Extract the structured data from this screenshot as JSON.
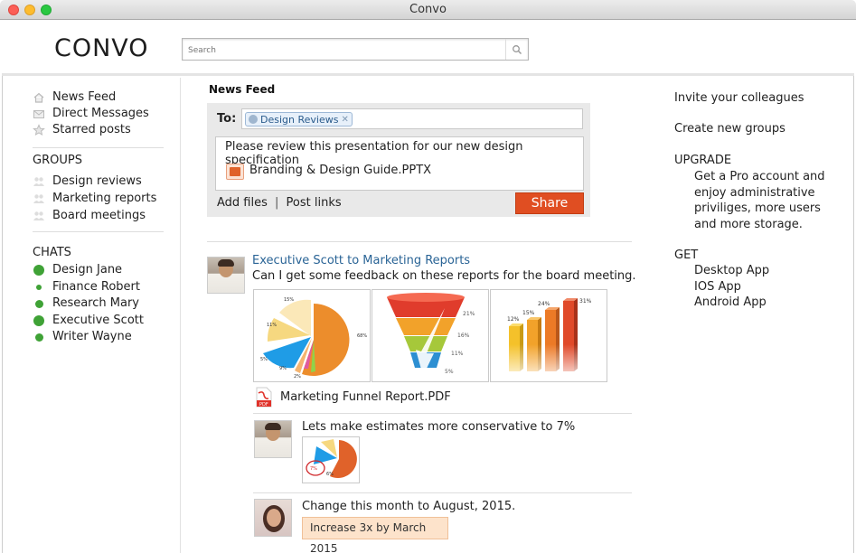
{
  "window": {
    "title": "Convo"
  },
  "header": {
    "logo": "CONVO",
    "search_placeholder": "Search"
  },
  "sidebar": {
    "nav": [
      "News Feed",
      "Direct Messages",
      "Starred posts"
    ],
    "groups_heading": "GROUPS",
    "groups": [
      "Design reviews",
      "Marketing reports",
      "Board meetings"
    ],
    "chats_heading": "CHATS",
    "chats": [
      "Design Jane",
      "Finance Robert",
      "Research Mary",
      "Executive Scott",
      "Writer Wayne"
    ]
  },
  "composer": {
    "heading": "News Feed",
    "to_label": "To:",
    "to_tag": "Design Reviews",
    "message": "Please review this presentation for our new design specification",
    "attachment": "Branding & Design Guide.PPTX",
    "add_files": "Add files",
    "divider": "|",
    "post_links": "Post links",
    "share": "Share"
  },
  "post": {
    "author_line": "Executive Scott to Marketing Reports",
    "text": "Can I get some feedback on these reports for the board meeting.",
    "attachment": "Marketing Funnel Report.PDF",
    "pdf_label": "PDF",
    "pie_labels": [
      "15%",
      "11%",
      "68%",
      "5%",
      "9%",
      "2%"
    ],
    "funnel_labels": [
      "21%",
      "16%",
      "11%",
      "5%"
    ],
    "bar_labels": [
      "12%",
      "15%",
      "24%",
      "31%"
    ]
  },
  "replies": [
    {
      "text": "Lets make estimates more conservative to 7%",
      "thumb_labels": [
        "7%",
        "6%"
      ]
    },
    {
      "text": "Change this month to August, 2015.",
      "note": "Increase 3x by March 2015"
    }
  ],
  "right": {
    "invite": "Invite your colleagues",
    "create": "Create new groups",
    "upgrade_heading": "UPGRADE",
    "upgrade_text": [
      "Get a Pro account and",
      "enjoy administrative",
      "priviliges, more users",
      "and more storage."
    ],
    "get_heading": "GET",
    "apps": [
      "Desktop App",
      "IOS App",
      "Android App"
    ]
  },
  "colors": {
    "accent": "#e04e22",
    "link": "#2a6496",
    "online": "#3fa236"
  }
}
